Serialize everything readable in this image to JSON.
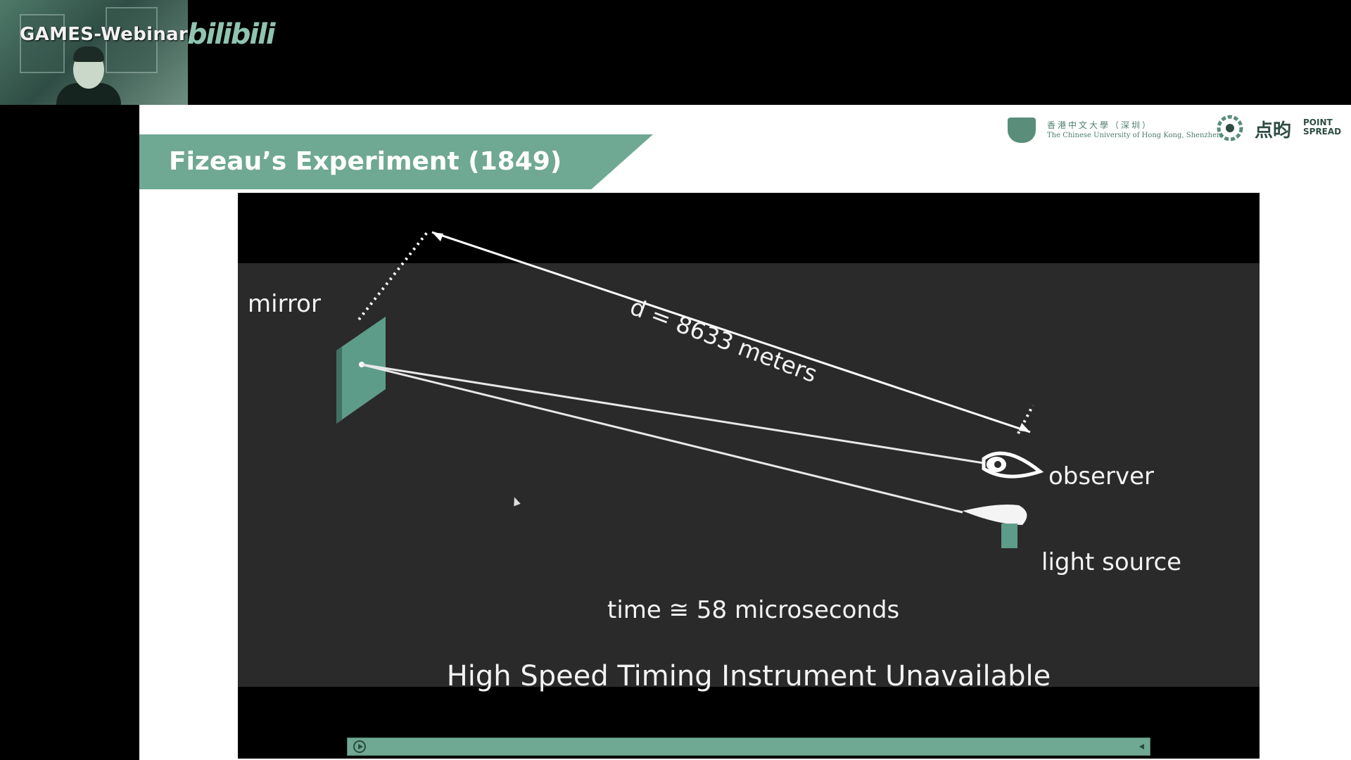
{
  "webcam": {
    "title": "GAMES-Webinar",
    "logo": "bilibili"
  },
  "slide": {
    "title": "Fizeau’s Experiment (1849)",
    "logos": {
      "cuhk_chinese": "香港中文大學（深圳）",
      "cuhk_english": "The Chinese University of Hong Kong, Shenzhen",
      "pointspread_chinese": "点昀",
      "pointspread_english_1": "POINT",
      "pointspread_english_2": "SPREAD"
    }
  },
  "video": {
    "labels": {
      "mirror": "mirror",
      "distance": "d = 8633 meters",
      "observer": "observer",
      "light_source": "light source",
      "time": "time ≅ 58 microseconds"
    },
    "caption": "High Speed Timing Instrument Unavailable"
  },
  "icons": {
    "mirror": "mirror-icon",
    "observer_eye": "eye-icon",
    "light_source": "lamp-icon",
    "play": "play-icon",
    "cursor": "cursor-icon"
  },
  "colors": {
    "accent": "#6fa893",
    "video_bg": "#2a2a2a"
  }
}
